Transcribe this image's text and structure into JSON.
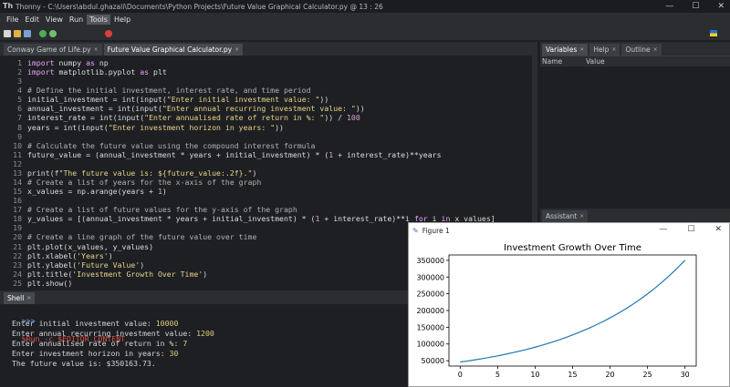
{
  "window": {
    "title": "Thonny  -  C:\\Users\\abdul.ghazali\\Documents\\Python Projects\\Future Value Graphical Calculator.py  @  13 : 26",
    "app_icon": "Th",
    "minimize_glyph": "—",
    "maximize_glyph": "☐",
    "close_glyph": "✕"
  },
  "menu": [
    "File",
    "Edit",
    "View",
    "Run",
    "Tools",
    "Help"
  ],
  "menu_active": "Tools",
  "toolbar_icons": [
    "new-file-icon",
    "open-file-icon",
    "save-icon",
    "run-icon",
    "debug-icon",
    "step-over-icon",
    "step-into-icon",
    "step-out-icon",
    "resume-icon",
    "stop-icon"
  ],
  "editor_tabs": [
    {
      "label": "Conway Game of Life.py",
      "close": "×"
    },
    {
      "label": "Future Value Graphical Calculator.py",
      "close": "×"
    }
  ],
  "code_lines": [
    {
      "n": "1",
      "tokens": [
        [
          "kw",
          "import"
        ],
        [
          "fn",
          " numpy "
        ],
        [
          "kw",
          "as"
        ],
        [
          "fn",
          " np"
        ]
      ]
    },
    {
      "n": "2",
      "tokens": [
        [
          "kw",
          "import"
        ],
        [
          "fn",
          " matplotlib.pyplot "
        ],
        [
          "kw",
          "as"
        ],
        [
          "fn",
          " plt"
        ]
      ]
    },
    {
      "n": "3",
      "tokens": []
    },
    {
      "n": "4",
      "tokens": [
        [
          "cm",
          "# Define the initial investment, interest rate, and time period"
        ]
      ]
    },
    {
      "n": "5",
      "tokens": [
        [
          "fn",
          "initial_investment = int(input("
        ],
        [
          "str",
          "\"Enter initial investment value: \""
        ],
        [
          "fn",
          "))"
        ]
      ]
    },
    {
      "n": "6",
      "tokens": [
        [
          "fn",
          "annual_investment = int(input("
        ],
        [
          "str",
          "\"Enter annual recurring investment value: \""
        ],
        [
          "fn",
          "))"
        ]
      ]
    },
    {
      "n": "7",
      "tokens": [
        [
          "fn",
          "interest_rate = int(input("
        ],
        [
          "str",
          "\"Enter annualised rate of return in %: \""
        ],
        [
          "fn",
          ")) / "
        ],
        [
          "num",
          "100"
        ]
      ]
    },
    {
      "n": "8",
      "tokens": [
        [
          "fn",
          "years = int(input("
        ],
        [
          "str",
          "\"Enter investment horizon in years: \""
        ],
        [
          "fn",
          "))"
        ]
      ]
    },
    {
      "n": "9",
      "tokens": []
    },
    {
      "n": "10",
      "tokens": [
        [
          "cm",
          "# Calculate the future value using the compound interest formula"
        ]
      ]
    },
    {
      "n": "11",
      "tokens": [
        [
          "fn",
          "future_value = (annual_investment * years + initial_investment) * ("
        ],
        [
          "num",
          "1"
        ],
        [
          "fn",
          " + interest_rate)**years"
        ]
      ]
    },
    {
      "n": "12",
      "tokens": []
    },
    {
      "n": "13",
      "tokens": [
        [
          "fn",
          "print(f"
        ],
        [
          "str",
          "\"The future value is: ${future_value:.2f}.\""
        ],
        [
          "fn",
          ")"
        ]
      ]
    },
    {
      "n": "14",
      "tokens": [
        [
          "cm",
          "# Create a list of years for the x-axis of the graph"
        ]
      ]
    },
    {
      "n": "15",
      "tokens": [
        [
          "fn",
          "x_values = np.arange(years + "
        ],
        [
          "num",
          "1"
        ],
        [
          "fn",
          ")"
        ]
      ]
    },
    {
      "n": "16",
      "tokens": []
    },
    {
      "n": "17",
      "tokens": [
        [
          "cm",
          "# Create a list of future values for the y-axis of the graph"
        ]
      ]
    },
    {
      "n": "18",
      "tokens": [
        [
          "fn",
          "y_values = [(annual_investment * years + initial_investment) * ("
        ],
        [
          "num",
          "1"
        ],
        [
          "fn",
          " + interest_rate)**i "
        ],
        [
          "kw",
          "for"
        ],
        [
          "fn",
          " i "
        ],
        [
          "kw",
          "in"
        ],
        [
          "fn",
          " x_values]"
        ]
      ]
    },
    {
      "n": "19",
      "tokens": []
    },
    {
      "n": "20",
      "tokens": [
        [
          "cm",
          "# Create a line graph of the future value over time"
        ]
      ]
    },
    {
      "n": "21",
      "tokens": [
        [
          "fn",
          "plt.plot(x_values, y_values)"
        ]
      ]
    },
    {
      "n": "22",
      "tokens": [
        [
          "fn",
          "plt.xlabel("
        ],
        [
          "str",
          "'Years'"
        ],
        [
          "fn",
          ")"
        ]
      ]
    },
    {
      "n": "23",
      "tokens": [
        [
          "fn",
          "plt.ylabel("
        ],
        [
          "str",
          "'Future Value'"
        ],
        [
          "fn",
          ")"
        ]
      ]
    },
    {
      "n": "24",
      "tokens": [
        [
          "fn",
          "plt.title("
        ],
        [
          "str",
          "'Investment Growth Over Time'"
        ],
        [
          "fn",
          ")"
        ]
      ]
    },
    {
      "n": "25",
      "tokens": [
        [
          "fn",
          "plt.show()"
        ]
      ]
    }
  ],
  "right_panel": {
    "tabs": [
      {
        "label": "Variables",
        "close": "×"
      },
      {
        "label": "Help",
        "close": "×"
      },
      {
        "label": "Outline",
        "close": "×"
      }
    ],
    "col_name": "Name",
    "col_value": "Value",
    "assistant_tab": {
      "label": "Assistant",
      "close": "×"
    }
  },
  "shell": {
    "tab": {
      "label": "Shell",
      "close": "×"
    },
    "prompt": ">>>",
    "command": "%Run -c $EDITOR_CONTENT",
    "lines": [
      {
        "text": "Enter initial investment value: ",
        "input": "10000"
      },
      {
        "text": "Enter annual recurring investment value: ",
        "input": "1200"
      },
      {
        "text": "Enter annualised rate of return in %: ",
        "input": "7"
      },
      {
        "text": "Enter investment horizon in years: ",
        "input": "30"
      },
      {
        "text": "The future value is: $350163.73.",
        "input": ""
      }
    ]
  },
  "figure": {
    "title": "Figure 1",
    "minimize_glyph": "—",
    "maximize_glyph": "☐",
    "close_glyph": "✕"
  },
  "chart_data": {
    "type": "line",
    "title": "Investment Growth Over Time",
    "xlabel": "",
    "ylabel": "",
    "xlim": [
      -1.5,
      31.5
    ],
    "ylim": [
      34000,
      366000
    ],
    "xticks": [
      0,
      5,
      10,
      15,
      20,
      25,
      30
    ],
    "yticks": [
      50000,
      100000,
      150000,
      200000,
      250000,
      300000,
      350000
    ],
    "series": [
      {
        "color": "#1f77b4",
        "x": [
          0,
          1,
          2,
          3,
          4,
          5,
          6,
          7,
          8,
          9,
          10,
          11,
          12,
          13,
          14,
          15,
          16,
          17,
          18,
          19,
          20,
          21,
          22,
          23,
          24,
          25,
          26,
          27,
          28,
          29,
          30
        ],
        "y": [
          46000,
          49220,
          52665,
          56352,
          60296,
          64517,
          69033,
          73865,
          79036,
          84569,
          90487,
          96822,
          103599,
          110851,
          118611,
          126913,
          135797,
          145303,
          155474,
          166358,
          178003,
          190463,
          203795,
          218061,
          233325,
          249658,
          267134,
          285833,
          305841,
          327250,
          350157
        ]
      }
    ]
  }
}
